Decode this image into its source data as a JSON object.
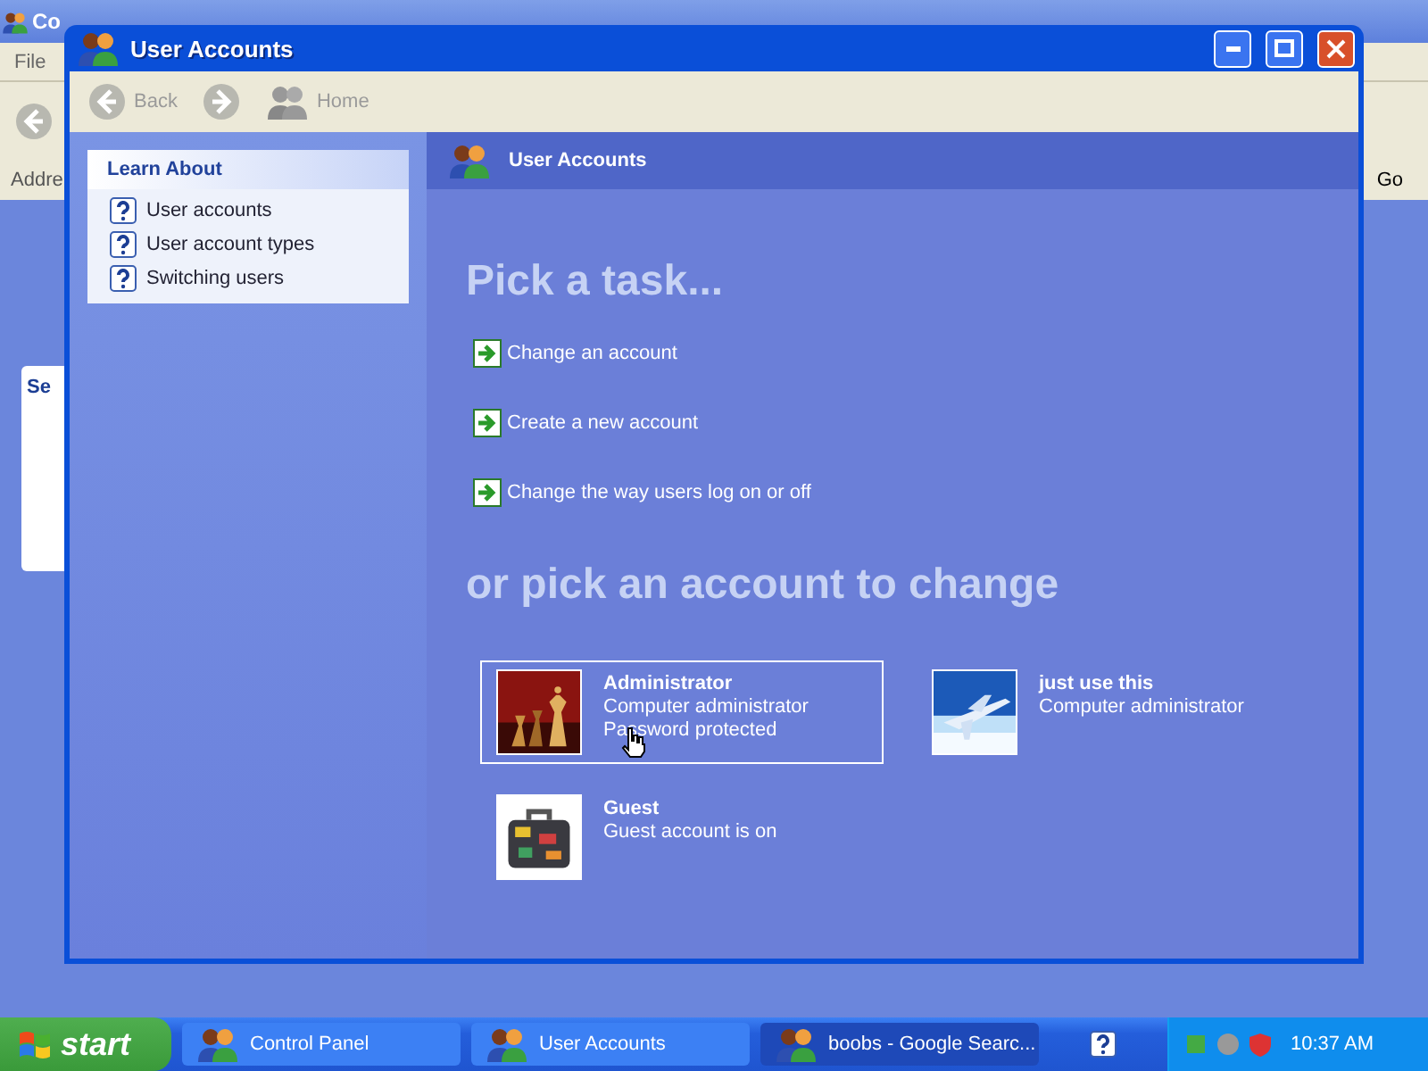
{
  "background_window": {
    "title": "Co",
    "menu": [
      "File"
    ],
    "address_label": "Addre",
    "go_button": "Go",
    "pane_title": "Se"
  },
  "window": {
    "title": "User Accounts",
    "toolbar": [
      {
        "label": "Back",
        "kind": "back"
      },
      {
        "kind": "forward"
      },
      {
        "label": "Home",
        "kind": "home"
      }
    ]
  },
  "learn_about": {
    "title": "Learn About",
    "items": [
      "User accounts",
      "User account types",
      "Switching users"
    ]
  },
  "header": {
    "title": "User Accounts"
  },
  "task_heading": "Pick a task...",
  "tasks": [
    "Change an account",
    "Create a new account",
    "Change the way users log on or off"
  ],
  "account_heading": "or pick an account to change",
  "accounts": [
    {
      "name": "Administrator",
      "lines": [
        "Computer administrator",
        "Password protected"
      ],
      "selected": true
    },
    {
      "name": "just use this",
      "lines": [
        "Computer administrator"
      ],
      "selected": false
    },
    {
      "name": "Guest",
      "lines": [
        "Guest account is on"
      ],
      "selected": false
    }
  ],
  "taskbar": {
    "start": "start",
    "tasks": [
      {
        "label": "Control Panel",
        "selected": false
      },
      {
        "label": "User Accounts",
        "selected": false
      },
      {
        "label": "boobs - Google Searc...",
        "selected": true
      }
    ],
    "clock": "10:37 AM"
  }
}
